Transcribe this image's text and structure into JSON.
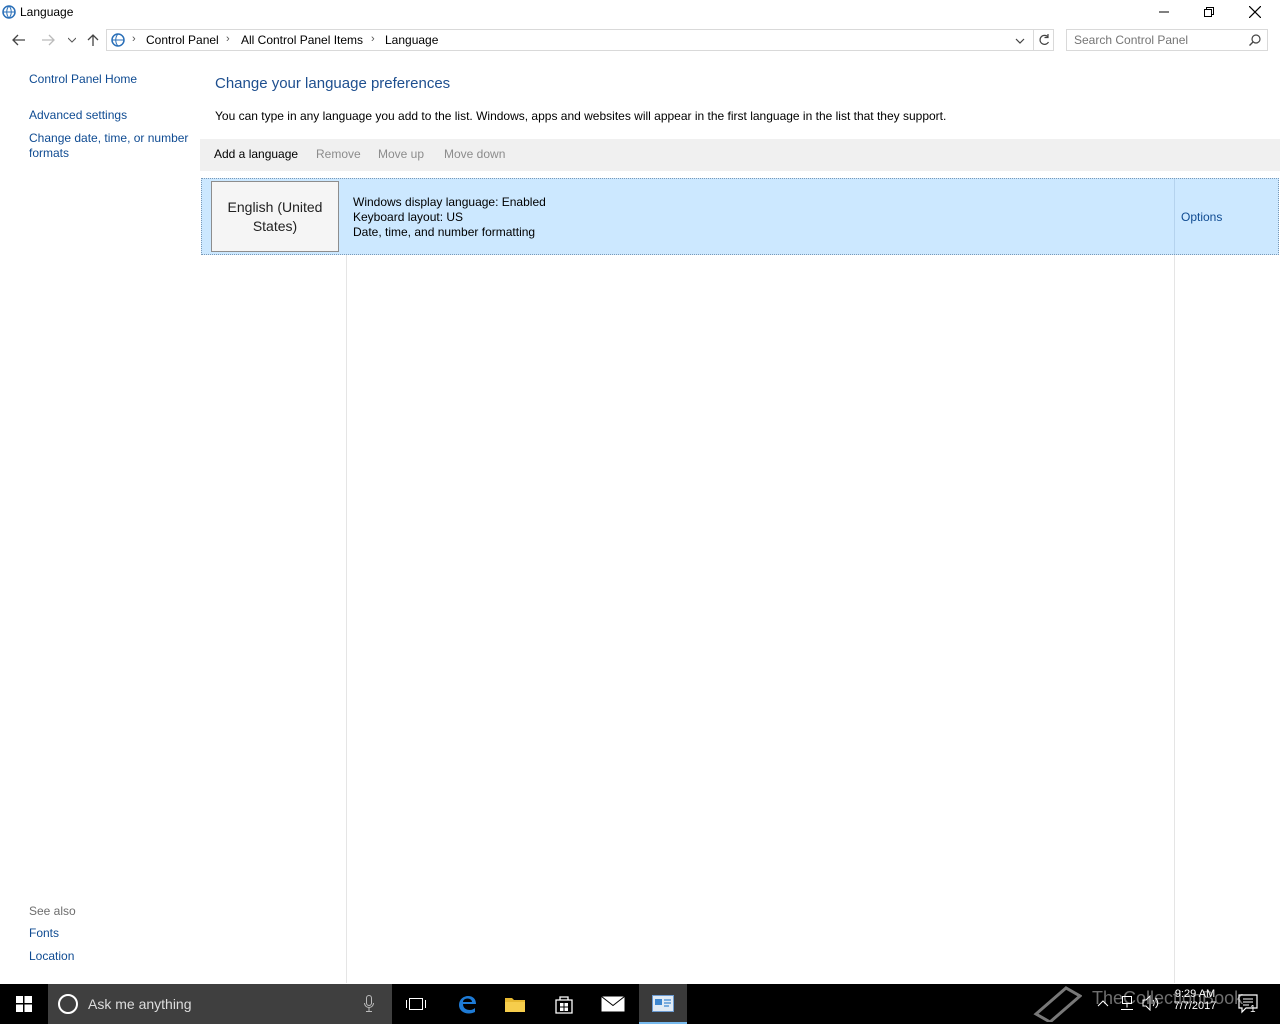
{
  "window": {
    "title": "Language"
  },
  "address": {
    "crumbs": [
      "Control Panel",
      "All Control Panel Items",
      "Language"
    ],
    "search_placeholder": "Search Control Panel"
  },
  "left_pane": {
    "home": "Control Panel Home",
    "advanced": "Advanced settings",
    "datetime_line1": "Change date, time, or number",
    "datetime_line2": "formats",
    "see_also": "See also",
    "fonts": "Fonts",
    "location": "Location"
  },
  "main": {
    "heading": "Change your language preferences",
    "description": "You can type in any language you add to the list. Windows, apps and websites will appear in the first language in the list that they support.",
    "toolbar": {
      "add": "Add a language",
      "remove": "Remove",
      "move_up": "Move up",
      "move_down": "Move down"
    },
    "languages": [
      {
        "name_line1": "English (United",
        "name_line2": "States)",
        "info1": "Windows display language: Enabled",
        "info2": "Keyboard layout: US",
        "info3": "Date, time, and number formatting",
        "options": "Options"
      }
    ]
  },
  "taskbar": {
    "search_text": "Ask me anything",
    "time": "9:29 AM",
    "date": "7/7/2017",
    "notification_count": "1",
    "watermark": "TheCollectionBook"
  },
  "colors": {
    "link": "#0f4b92",
    "heading": "#1e4f8f",
    "selection": "#cce8ff",
    "taskbar": "#000000"
  }
}
